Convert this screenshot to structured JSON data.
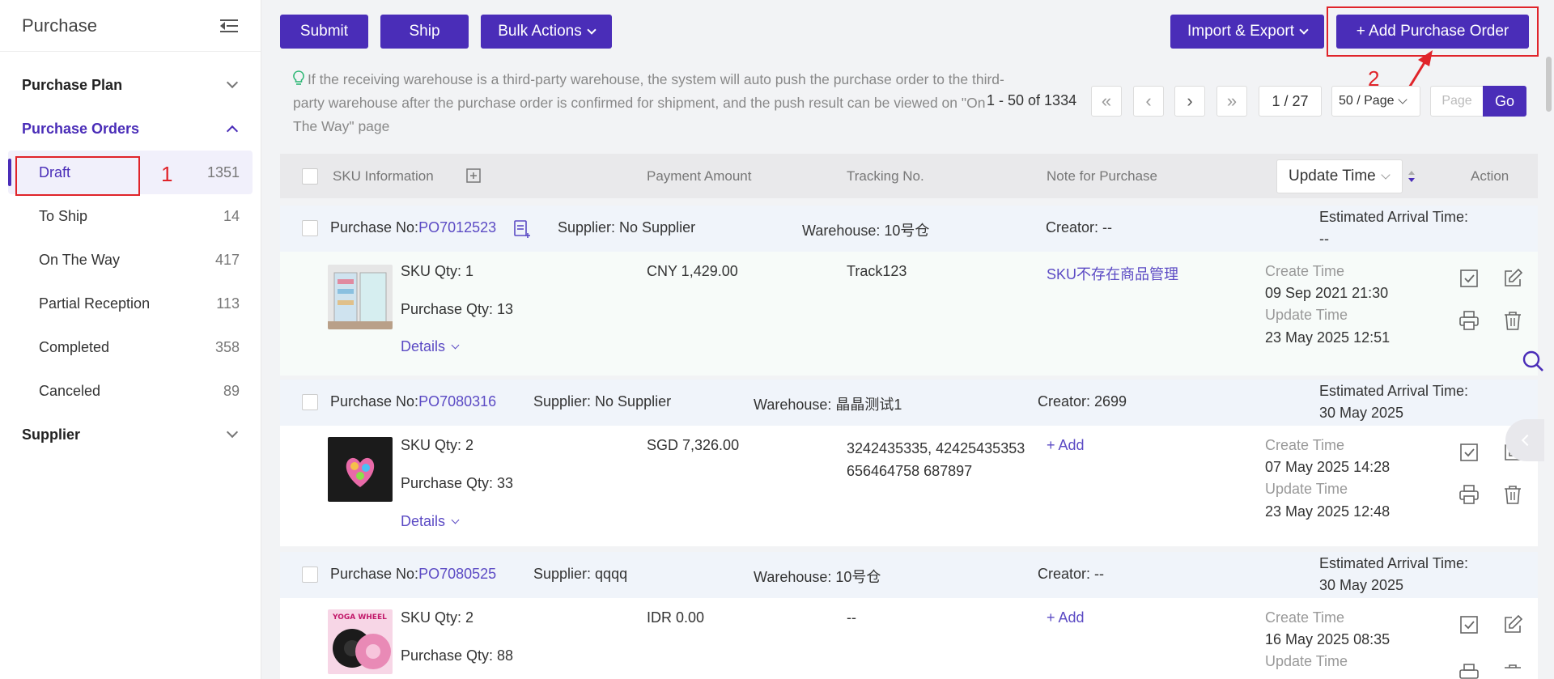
{
  "sidebar": {
    "title": "Purchase",
    "groups": [
      {
        "label": "Purchase Plan"
      },
      {
        "label": "Purchase Orders"
      },
      {
        "label": "Supplier"
      }
    ],
    "items": [
      {
        "label": "Draft",
        "count": "1351"
      },
      {
        "label": "To Ship",
        "count": "14"
      },
      {
        "label": "On The Way",
        "count": "417"
      },
      {
        "label": "Partial Reception",
        "count": "113"
      },
      {
        "label": "Completed",
        "count": "358"
      },
      {
        "label": "Canceled",
        "count": "89"
      }
    ],
    "annotation": "1"
  },
  "toolbar": {
    "submit": "Submit",
    "ship": "Ship",
    "bulk": "Bulk Actions",
    "import_export": "Import & Export",
    "add_po": "+ Add Purchase Order",
    "annotation": "2"
  },
  "tip": "If the receiving warehouse is a third-party warehouse, the system will auto push the purchase order to the third-party warehouse after the purchase order is confirmed for shipment, and the push result can be viewed on \"On The Way\" page",
  "pager": {
    "range": "1 - 50 of 1334",
    "page": "1 / 27",
    "per_page": "50 / Page",
    "page_placeholder": "Page",
    "go": "Go"
  },
  "table": {
    "headers": {
      "sku": "SKU Information",
      "payment": "Payment Amount",
      "tracking": "Tracking No.",
      "note": "Note for Purchase",
      "sort": "Update Time",
      "action": "Action"
    }
  },
  "labels": {
    "po_prefix": "Purchase No:",
    "eta": "Estimated Arrival Time:",
    "create": "Create Time",
    "update": "Update Time",
    "details": "Details",
    "add": "+ Add"
  },
  "orders": [
    {
      "po": "PO7012523",
      "supplier": "Supplier: No Supplier",
      "warehouse": "Warehouse: 10号仓",
      "creator": "Creator: --",
      "eta": "--",
      "sku_qty": "SKU Qty: 1",
      "purchase_qty": "Purchase Qty: 13",
      "amount": "CNY 1,429.00",
      "tracking": "Track123",
      "note": "SKU不存在商品管理",
      "create_time": "09 Sep 2021 21:30",
      "update_time": "23 May 2025 12:51"
    },
    {
      "po": "PO7080316",
      "supplier": "Supplier: No Supplier",
      "warehouse": "Warehouse: 晶晶测试1",
      "creator": "Creator: 2699",
      "eta": "30 May 2025",
      "sku_qty": "SKU Qty: 2",
      "purchase_qty": "Purchase Qty: 33",
      "amount": "SGD 7,326.00",
      "tracking": "3242435335, 42425435353656464758 687897",
      "note": "+ Add",
      "create_time": "07 May 2025 14:28",
      "update_time": "23 May 2025 12:48"
    },
    {
      "po": "PO7080525",
      "supplier": "Supplier: qqqq",
      "warehouse": "Warehouse: 10号仓",
      "creator": "Creator: --",
      "eta": "30 May 2025",
      "sku_qty": "SKU Qty: 2",
      "purchase_qty": "Purchase Qty: 88",
      "amount": "IDR 0.00",
      "tracking": "--",
      "note": "+ Add",
      "create_time": "16 May 2025 08:35",
      "update_time": ""
    }
  ],
  "colors": {
    "accent": "#4a2db8",
    "annotation": "#e0242a",
    "link": "#5b4ac4"
  }
}
